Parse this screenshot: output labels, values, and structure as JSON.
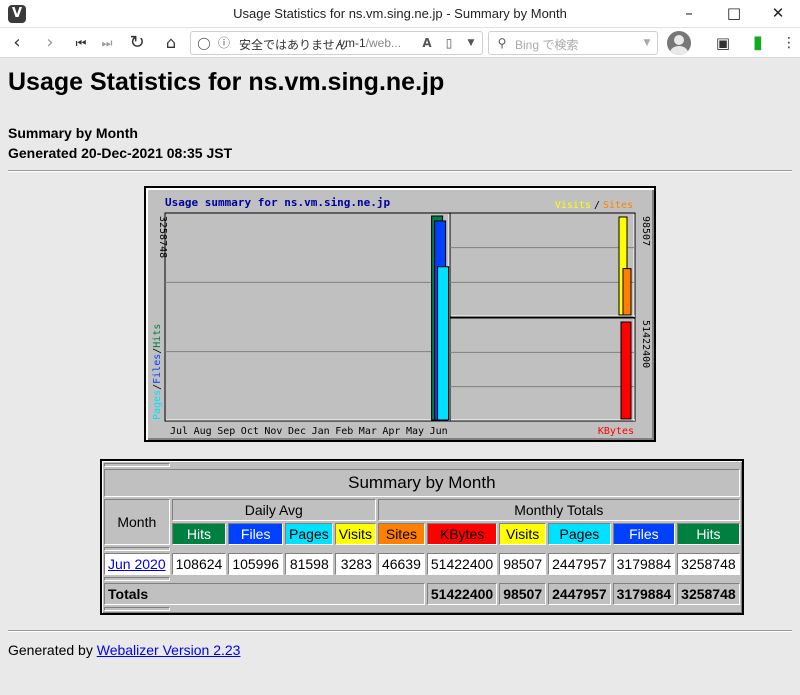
{
  "browser": {
    "window_title": "Usage Statistics for ns.vm.sing.ne.jp - Summary by Month",
    "security_label": "安全ではありません",
    "url_host": "vm-1",
    "url_rest": "/web...",
    "search_placeholder": "Bing で検索",
    "colors": {
      "accent": "#3a3a3a"
    },
    "icons": [
      "vivaldi-logo",
      "back-icon",
      "forward-icon",
      "rewind-icon",
      "fast-forward-icon",
      "reload-icon",
      "home-icon",
      "shield-icon",
      "info-icon",
      "translate-icon",
      "bookmark-icon",
      "dropdown-icon",
      "search-engine-icon",
      "profile-icon",
      "capture-icon",
      "panel-icon",
      "menu-icon"
    ]
  },
  "page": {
    "title": "Usage Statistics for ns.vm.sing.ne.jp",
    "subtitle": "Summary by Month",
    "generated": "Generated 20-Dec-2021 08:35 JST",
    "footer_prefix": "Generated by",
    "footer_link": "Webalizer Version 2.23"
  },
  "chart_data": {
    "type": "bar",
    "title": "Usage summary for ns.vm.sing.ne.jp",
    "categories": [
      "Jul",
      "Aug",
      "Sep",
      "Oct",
      "Nov",
      "Dec",
      "Jan",
      "Feb",
      "Mar",
      "Apr",
      "May",
      "Jun"
    ],
    "left_panel": {
      "axis_label_parts": [
        "Pages",
        "Files",
        "Hits"
      ],
      "max_label": "3258748",
      "max": 3258748,
      "series": [
        {
          "name": "Hits",
          "color": "#008040",
          "values": [
            0,
            0,
            0,
            0,
            0,
            0,
            0,
            0,
            0,
            0,
            0,
            3258748
          ]
        },
        {
          "name": "Files",
          "color": "#0040ff",
          "values": [
            0,
            0,
            0,
            0,
            0,
            0,
            0,
            0,
            0,
            0,
            0,
            3179884
          ]
        },
        {
          "name": "Pages",
          "color": "#00e0ff",
          "values": [
            0,
            0,
            0,
            0,
            0,
            0,
            0,
            0,
            0,
            0,
            0,
            2447957
          ]
        }
      ]
    },
    "right_top_panel": {
      "legend_parts": [
        "Visits",
        "Sites"
      ],
      "max_label": "98507",
      "max": 98507,
      "series": [
        {
          "name": "Visits",
          "color": "#ffff00",
          "values": [
            98507
          ]
        },
        {
          "name": "Sites",
          "color": "#ff8000",
          "values": [
            46639
          ]
        }
      ]
    },
    "right_bottom_panel": {
      "legend": "KBytes",
      "max_label": "51422400",
      "max": 51422400,
      "series": [
        {
          "name": "KBytes",
          "color": "#ff0000",
          "values": [
            51422400
          ]
        }
      ]
    }
  },
  "table": {
    "caption": "Summary by Month",
    "col_month": "Month",
    "group_daily": "Daily Avg",
    "group_monthly": "Monthly Totals",
    "headers": [
      {
        "label": "Hits",
        "color": "#008040"
      },
      {
        "label": "Files",
        "color": "#0040ff"
      },
      {
        "label": "Pages",
        "color": "#00e0ff"
      },
      {
        "label": "Visits",
        "color": "#ffff00"
      },
      {
        "label": "Sites",
        "color": "#ff8000"
      },
      {
        "label": "KBytes",
        "color": "#ff0000"
      },
      {
        "label": "Visits",
        "color": "#ffff00"
      },
      {
        "label": "Pages",
        "color": "#00e0ff"
      },
      {
        "label": "Files",
        "color": "#0040ff"
      },
      {
        "label": "Hits",
        "color": "#008040"
      }
    ],
    "rows": [
      {
        "month": "Jun 2020",
        "values": [
          "108624",
          "105996",
          "81598",
          "3283",
          "46639",
          "51422400",
          "98507",
          "2447957",
          "3179884",
          "3258748"
        ]
      }
    ],
    "totals_label": "Totals",
    "totals": [
      "51422400",
      "98507",
      "2447957",
      "3179884",
      "3258748"
    ]
  }
}
